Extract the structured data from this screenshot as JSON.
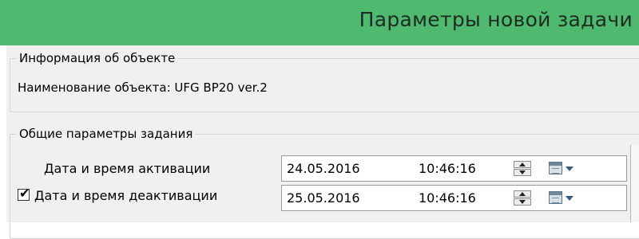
{
  "window": {
    "title": "Параметры новой задачи"
  },
  "object_info": {
    "caption": "Информация об объекте",
    "name_line": "Наименование объекта: UFG BP20 ver.2"
  },
  "general_params": {
    "caption": "Общие параметры задания",
    "activation": {
      "label": "Дата и время активации",
      "date": "24.05.2016",
      "time": "10:46:16"
    },
    "deactivation": {
      "checked": true,
      "label": "Дата и время деактивации",
      "date": "25.05.2016",
      "time": "10:46:16"
    }
  },
  "icons": {
    "spin": "spin-updown-icon",
    "calendar": "calendar-dropdown-icon",
    "check": "checkmark-icon"
  },
  "colors": {
    "titlebar": "#4fb970",
    "panel": "#f0f0f0"
  }
}
